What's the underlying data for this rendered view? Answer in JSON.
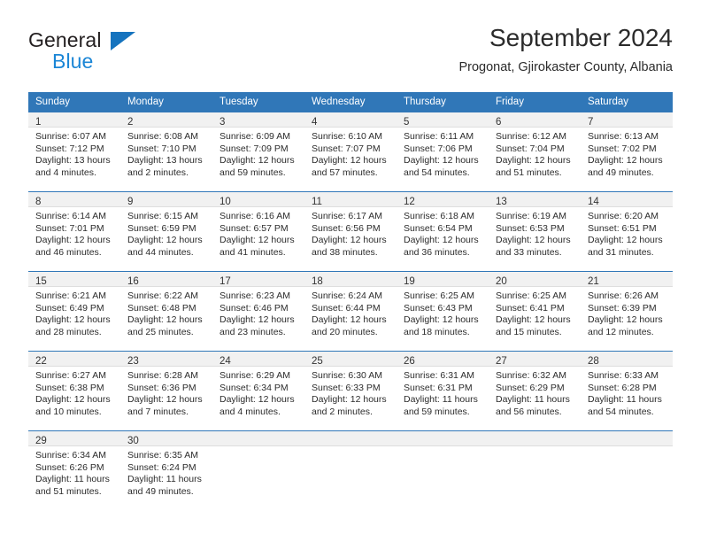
{
  "logo": {
    "word_one": "General",
    "word_two": "Blue",
    "triangle": "blue-triangle"
  },
  "header": {
    "title": "September 2024",
    "subtitle": "Progonat, Gjirokaster County, Albania"
  },
  "colors": {
    "header_blue": "#3077b8",
    "daynum_band": "#f1f1f1",
    "logo_blue": "#1b86d6",
    "text": "#2c2c2c"
  },
  "calendar": {
    "weekday_headers": [
      "Sunday",
      "Monday",
      "Tuesday",
      "Wednesday",
      "Thursday",
      "Friday",
      "Saturday"
    ],
    "weeks": [
      [
        {
          "day": "1",
          "sunrise": "Sunrise: 6:07 AM",
          "sunset": "Sunset: 7:12 PM",
          "daylight_1": "Daylight: 13 hours",
          "daylight_2": "and 4 minutes."
        },
        {
          "day": "2",
          "sunrise": "Sunrise: 6:08 AM",
          "sunset": "Sunset: 7:10 PM",
          "daylight_1": "Daylight: 13 hours",
          "daylight_2": "and 2 minutes."
        },
        {
          "day": "3",
          "sunrise": "Sunrise: 6:09 AM",
          "sunset": "Sunset: 7:09 PM",
          "daylight_1": "Daylight: 12 hours",
          "daylight_2": "and 59 minutes."
        },
        {
          "day": "4",
          "sunrise": "Sunrise: 6:10 AM",
          "sunset": "Sunset: 7:07 PM",
          "daylight_1": "Daylight: 12 hours",
          "daylight_2": "and 57 minutes."
        },
        {
          "day": "5",
          "sunrise": "Sunrise: 6:11 AM",
          "sunset": "Sunset: 7:06 PM",
          "daylight_1": "Daylight: 12 hours",
          "daylight_2": "and 54 minutes."
        },
        {
          "day": "6",
          "sunrise": "Sunrise: 6:12 AM",
          "sunset": "Sunset: 7:04 PM",
          "daylight_1": "Daylight: 12 hours",
          "daylight_2": "and 51 minutes."
        },
        {
          "day": "7",
          "sunrise": "Sunrise: 6:13 AM",
          "sunset": "Sunset: 7:02 PM",
          "daylight_1": "Daylight: 12 hours",
          "daylight_2": "and 49 minutes."
        }
      ],
      [
        {
          "day": "8",
          "sunrise": "Sunrise: 6:14 AM",
          "sunset": "Sunset: 7:01 PM",
          "daylight_1": "Daylight: 12 hours",
          "daylight_2": "and 46 minutes."
        },
        {
          "day": "9",
          "sunrise": "Sunrise: 6:15 AM",
          "sunset": "Sunset: 6:59 PM",
          "daylight_1": "Daylight: 12 hours",
          "daylight_2": "and 44 minutes."
        },
        {
          "day": "10",
          "sunrise": "Sunrise: 6:16 AM",
          "sunset": "Sunset: 6:57 PM",
          "daylight_1": "Daylight: 12 hours",
          "daylight_2": "and 41 minutes."
        },
        {
          "day": "11",
          "sunrise": "Sunrise: 6:17 AM",
          "sunset": "Sunset: 6:56 PM",
          "daylight_1": "Daylight: 12 hours",
          "daylight_2": "and 38 minutes."
        },
        {
          "day": "12",
          "sunrise": "Sunrise: 6:18 AM",
          "sunset": "Sunset: 6:54 PM",
          "daylight_1": "Daylight: 12 hours",
          "daylight_2": "and 36 minutes."
        },
        {
          "day": "13",
          "sunrise": "Sunrise: 6:19 AM",
          "sunset": "Sunset: 6:53 PM",
          "daylight_1": "Daylight: 12 hours",
          "daylight_2": "and 33 minutes."
        },
        {
          "day": "14",
          "sunrise": "Sunrise: 6:20 AM",
          "sunset": "Sunset: 6:51 PM",
          "daylight_1": "Daylight: 12 hours",
          "daylight_2": "and 31 minutes."
        }
      ],
      [
        {
          "day": "15",
          "sunrise": "Sunrise: 6:21 AM",
          "sunset": "Sunset: 6:49 PM",
          "daylight_1": "Daylight: 12 hours",
          "daylight_2": "and 28 minutes."
        },
        {
          "day": "16",
          "sunrise": "Sunrise: 6:22 AM",
          "sunset": "Sunset: 6:48 PM",
          "daylight_1": "Daylight: 12 hours",
          "daylight_2": "and 25 minutes."
        },
        {
          "day": "17",
          "sunrise": "Sunrise: 6:23 AM",
          "sunset": "Sunset: 6:46 PM",
          "daylight_1": "Daylight: 12 hours",
          "daylight_2": "and 23 minutes."
        },
        {
          "day": "18",
          "sunrise": "Sunrise: 6:24 AM",
          "sunset": "Sunset: 6:44 PM",
          "daylight_1": "Daylight: 12 hours",
          "daylight_2": "and 20 minutes."
        },
        {
          "day": "19",
          "sunrise": "Sunrise: 6:25 AM",
          "sunset": "Sunset: 6:43 PM",
          "daylight_1": "Daylight: 12 hours",
          "daylight_2": "and 18 minutes."
        },
        {
          "day": "20",
          "sunrise": "Sunrise: 6:25 AM",
          "sunset": "Sunset: 6:41 PM",
          "daylight_1": "Daylight: 12 hours",
          "daylight_2": "and 15 minutes."
        },
        {
          "day": "21",
          "sunrise": "Sunrise: 6:26 AM",
          "sunset": "Sunset: 6:39 PM",
          "daylight_1": "Daylight: 12 hours",
          "daylight_2": "and 12 minutes."
        }
      ],
      [
        {
          "day": "22",
          "sunrise": "Sunrise: 6:27 AM",
          "sunset": "Sunset: 6:38 PM",
          "daylight_1": "Daylight: 12 hours",
          "daylight_2": "and 10 minutes."
        },
        {
          "day": "23",
          "sunrise": "Sunrise: 6:28 AM",
          "sunset": "Sunset: 6:36 PM",
          "daylight_1": "Daylight: 12 hours",
          "daylight_2": "and 7 minutes."
        },
        {
          "day": "24",
          "sunrise": "Sunrise: 6:29 AM",
          "sunset": "Sunset: 6:34 PM",
          "daylight_1": "Daylight: 12 hours",
          "daylight_2": "and 4 minutes."
        },
        {
          "day": "25",
          "sunrise": "Sunrise: 6:30 AM",
          "sunset": "Sunset: 6:33 PM",
          "daylight_1": "Daylight: 12 hours",
          "daylight_2": "and 2 minutes."
        },
        {
          "day": "26",
          "sunrise": "Sunrise: 6:31 AM",
          "sunset": "Sunset: 6:31 PM",
          "daylight_1": "Daylight: 11 hours",
          "daylight_2": "and 59 minutes."
        },
        {
          "day": "27",
          "sunrise": "Sunrise: 6:32 AM",
          "sunset": "Sunset: 6:29 PM",
          "daylight_1": "Daylight: 11 hours",
          "daylight_2": "and 56 minutes."
        },
        {
          "day": "28",
          "sunrise": "Sunrise: 6:33 AM",
          "sunset": "Sunset: 6:28 PM",
          "daylight_1": "Daylight: 11 hours",
          "daylight_2": "and 54 minutes."
        }
      ],
      [
        {
          "day": "29",
          "sunrise": "Sunrise: 6:34 AM",
          "sunset": "Sunset: 6:26 PM",
          "daylight_1": "Daylight: 11 hours",
          "daylight_2": "and 51 minutes."
        },
        {
          "day": "30",
          "sunrise": "Sunrise: 6:35 AM",
          "sunset": "Sunset: 6:24 PM",
          "daylight_1": "Daylight: 11 hours",
          "daylight_2": "and 49 minutes."
        },
        {
          "day": "",
          "sunrise": "",
          "sunset": "",
          "daylight_1": "",
          "daylight_2": ""
        },
        {
          "day": "",
          "sunrise": "",
          "sunset": "",
          "daylight_1": "",
          "daylight_2": ""
        },
        {
          "day": "",
          "sunrise": "",
          "sunset": "",
          "daylight_1": "",
          "daylight_2": ""
        },
        {
          "day": "",
          "sunrise": "",
          "sunset": "",
          "daylight_1": "",
          "daylight_2": ""
        },
        {
          "day": "",
          "sunrise": "",
          "sunset": "",
          "daylight_1": "",
          "daylight_2": ""
        }
      ]
    ]
  }
}
